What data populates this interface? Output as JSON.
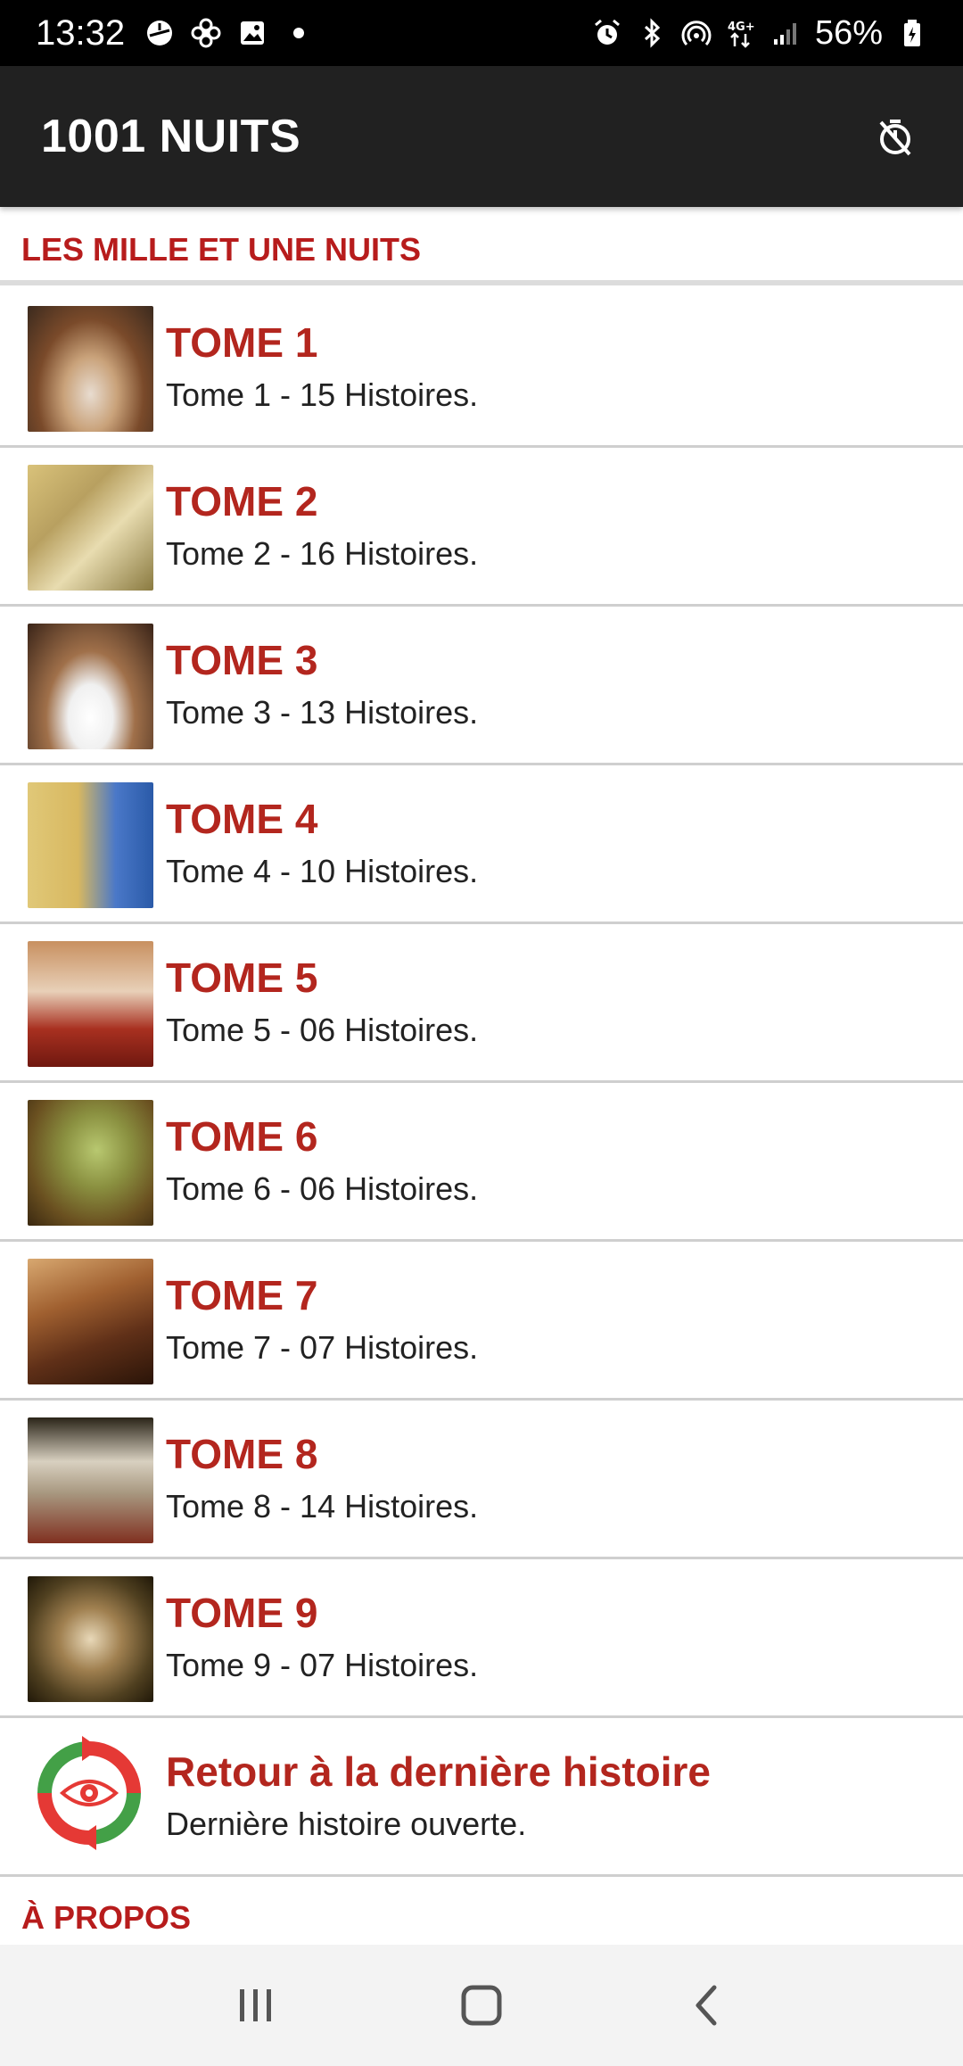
{
  "status_bar": {
    "time": "13:32",
    "battery": "56%",
    "left_icons": [
      "app-notification-icon",
      "fan-icon",
      "image-icon",
      "dot-icon"
    ],
    "right_icons": [
      "alarm-icon",
      "bluetooth-icon",
      "hotspot-icon",
      "4g-data-icon",
      "signal-icon",
      "battery-icon"
    ],
    "network_label": "4G+"
  },
  "app_bar": {
    "title": "1001 NUITS",
    "action_icon": "timer-off-icon"
  },
  "section_title": "LES MILLE ET UNE NUITS",
  "tomes": [
    {
      "title": "TOME 1",
      "subtitle": "Tome 1 - 15 Histoires."
    },
    {
      "title": "TOME 2",
      "subtitle": "Tome 2 - 16 Histoires."
    },
    {
      "title": "TOME 3",
      "subtitle": "Tome 3 - 13 Histoires."
    },
    {
      "title": "TOME 4",
      "subtitle": "Tome 4 - 10 Histoires."
    },
    {
      "title": "TOME 5",
      "subtitle": "Tome 5 - 06 Histoires."
    },
    {
      "title": "TOME 6",
      "subtitle": "Tome 6 - 06 Histoires."
    },
    {
      "title": "TOME 7",
      "subtitle": "Tome 7 - 07 Histoires."
    },
    {
      "title": "TOME 8",
      "subtitle": "Tome 8 - 14 Histoires."
    },
    {
      "title": "TOME 9",
      "subtitle": "Tome 9 - 07 Histoires."
    }
  ],
  "last_story": {
    "title": "Retour à la dernière histoire",
    "subtitle": "Dernière histoire ouverte."
  },
  "about_title": "À PROPOS",
  "colors": {
    "accent": "#b3261e",
    "app_bar": "#212121",
    "status_bar": "#000000"
  },
  "nav": [
    "recents-icon",
    "home-icon",
    "back-icon"
  ]
}
